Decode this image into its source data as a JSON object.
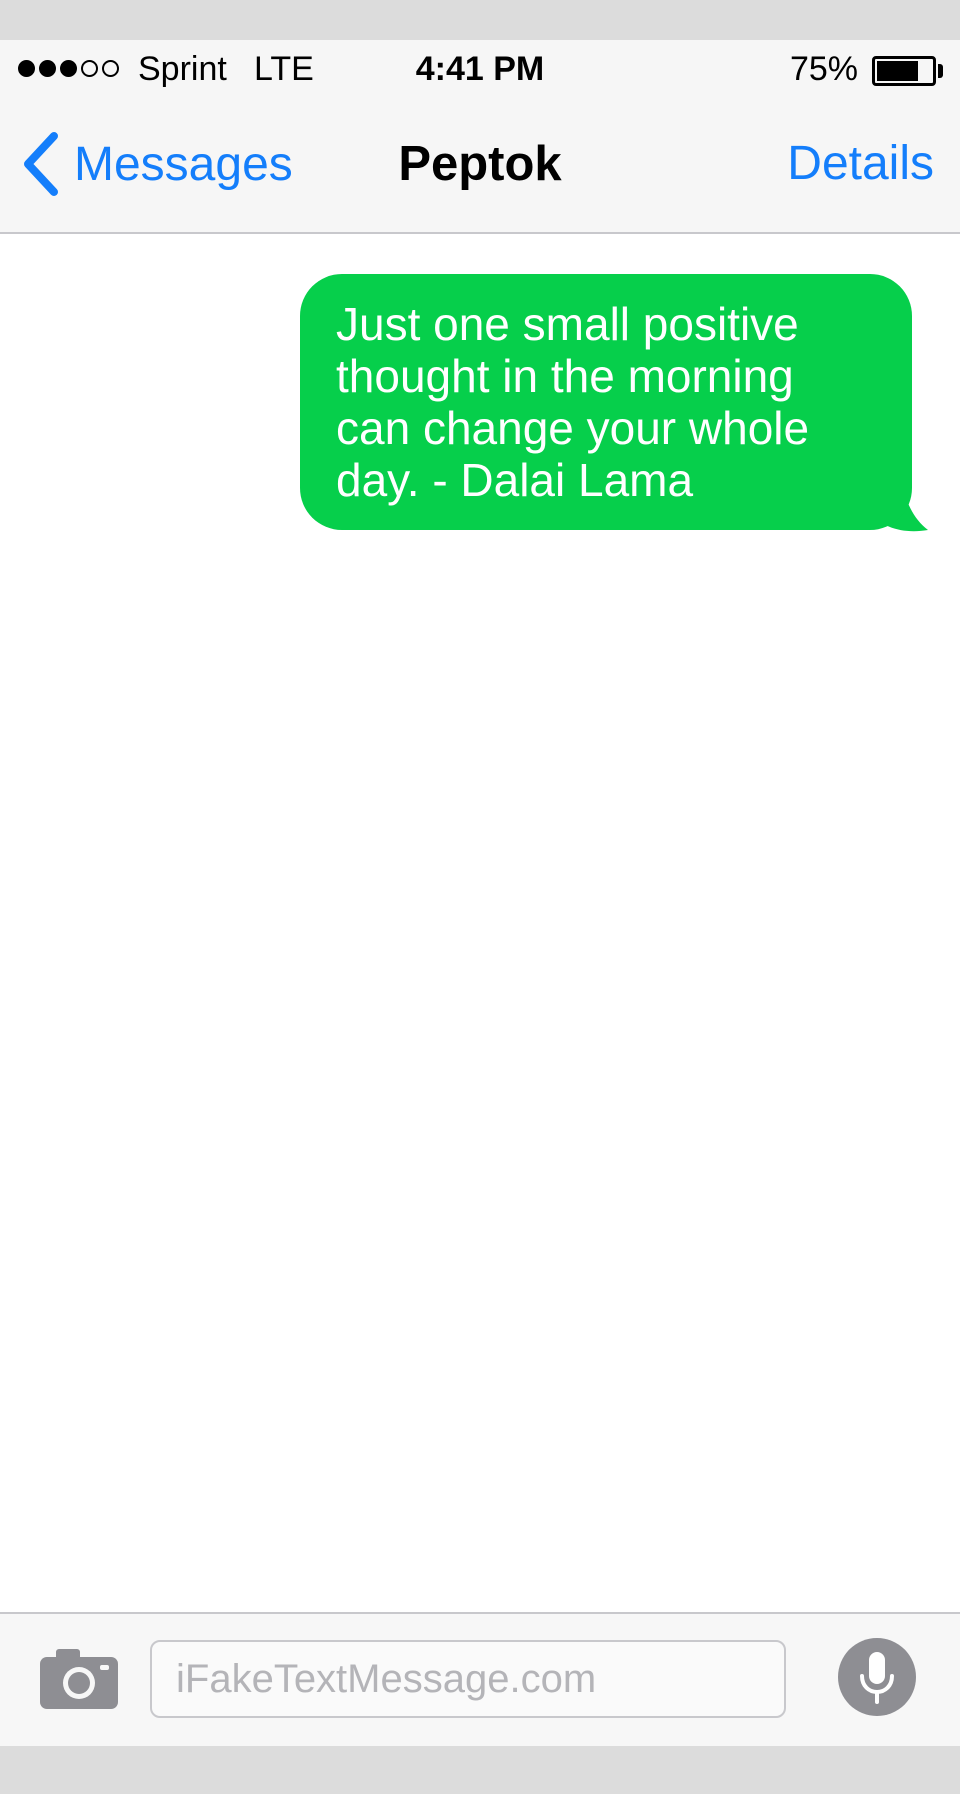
{
  "status_bar": {
    "signal_dots": {
      "filled": 3,
      "total": 5
    },
    "carrier": "Sprint",
    "network": "LTE",
    "time": "4:41 PM",
    "battery_percent": "75%",
    "battery_level": 0.75
  },
  "nav_bar": {
    "back_label": "Messages",
    "back_icon": "chevron-left-icon",
    "title": "Peptok",
    "details_label": "Details"
  },
  "messages": [
    {
      "direction": "outgoing",
      "text": "Just one small positive thought in the morning can change your whole day. - Dalai Lama"
    }
  ],
  "input_bar": {
    "camera_icon": "camera-icon",
    "placeholder": "iFakeTextMessage.com",
    "value": "",
    "mic_icon": "microphone-icon"
  },
  "colors": {
    "accent": "#147efb",
    "bubble_green": "#06cf4b",
    "bar_background": "#f6f6f6",
    "icon_gray": "#8e8e93",
    "frame_gray": "#dcdcdc"
  }
}
